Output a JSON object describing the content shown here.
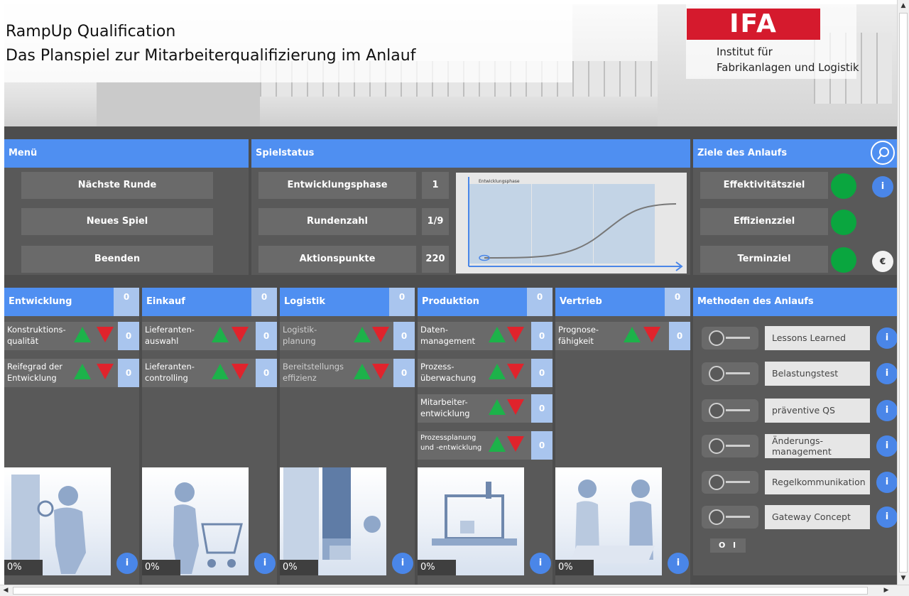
{
  "header": {
    "title_line1": "RampUp Qualification",
    "title_line2": "Das Planspiel zur Mitarbeiterqualifizierung im Anlauf",
    "logo_text": "IFA",
    "institute_line1": "Institut für",
    "institute_line2": "Fabrikanlagen und Logistik"
  },
  "menu": {
    "title": "Menü",
    "buttons": [
      "Nächste Runde",
      "Neues Spiel",
      "Beenden"
    ]
  },
  "status": {
    "title": "Spielstatus",
    "rows": [
      {
        "label": "Entwicklungsphase",
        "value": "1"
      },
      {
        "label": "Rundenzahl",
        "value": "1/9"
      },
      {
        "label": "Aktionspunkte",
        "value": "220"
      }
    ],
    "graph_label": "Entwicklungsphase"
  },
  "goals": {
    "title": "Ziele des Anlaufs",
    "items": [
      {
        "label": "Effektivitätsziel",
        "color": "#0aa63f"
      },
      {
        "label": "Effizienzziel",
        "color": "#0aa63f"
      },
      {
        "label": "Terminziel",
        "color": "#0aa63f"
      }
    ],
    "info_label": "i",
    "euro_label": "€"
  },
  "departments": [
    {
      "name": "Entwicklung",
      "count": "0",
      "percent": "0%",
      "info": "i",
      "actions": [
        {
          "label_l1": "Konstruktions-",
          "label_l2": "qualität",
          "count": "0"
        },
        {
          "label_l1": "Reifegrad der",
          "label_l2": "Entwicklung",
          "count": "0"
        }
      ]
    },
    {
      "name": "Einkauf",
      "count": "0",
      "percent": "0%",
      "info": "i",
      "actions": [
        {
          "label_l1": "Lieferanten-",
          "label_l2": "auswahl",
          "count": "0"
        },
        {
          "label_l1": "Lieferanten-",
          "label_l2": "controlling",
          "count": "0"
        }
      ]
    },
    {
      "name": "Logistik",
      "count": "0",
      "percent": "0%",
      "info": "i",
      "actions": [
        {
          "label_l1": "Logistik-",
          "label_l2": "planung",
          "count": "0"
        },
        {
          "label_l1": "Bereitstellungs",
          "label_l2": "effizienz",
          "count": "0"
        }
      ]
    },
    {
      "name": "Produktion",
      "count": "0",
      "percent": "0%",
      "info": "i",
      "actions": [
        {
          "label_l1": "Daten-",
          "label_l2": "management",
          "count": "0"
        },
        {
          "label_l1": "Prozess-",
          "label_l2": "überwachung",
          "count": "0"
        },
        {
          "label_l1": "Mitarbeiter-",
          "label_l2": "entwicklung",
          "count": "0"
        },
        {
          "label_l1": "Prozessplanung",
          "label_l2": "und -entwicklung",
          "count": "0"
        }
      ]
    },
    {
      "name": "Vertrieb",
      "count": "0",
      "percent": "0%",
      "info": "i",
      "actions": [
        {
          "label_l1": "Prognose-",
          "label_l2": "fähigkeit",
          "count": "0"
        }
      ]
    }
  ],
  "methods": {
    "title": "Methoden des Anlaufs",
    "items": [
      {
        "label_l1": "Lessons Learned",
        "label_l2": ""
      },
      {
        "label_l1": "Belastungstest",
        "label_l2": ""
      },
      {
        "label_l1": "präventive QS",
        "label_l2": ""
      },
      {
        "label_l1": "Änderungs-",
        "label_l2": "management"
      },
      {
        "label_l1": "Regelkommunikation",
        "label_l2": ""
      },
      {
        "label_l1": "Gateway Concept",
        "label_l2": ""
      }
    ],
    "switch_off": "O",
    "switch_on": "I",
    "info_label": "i"
  },
  "colors": {
    "accent": "#4f8ff1",
    "panel": "#595959",
    "button": "#6a6a6a",
    "up": "#1db24a",
    "down": "#e0232c",
    "brand": "#d51a2d"
  }
}
